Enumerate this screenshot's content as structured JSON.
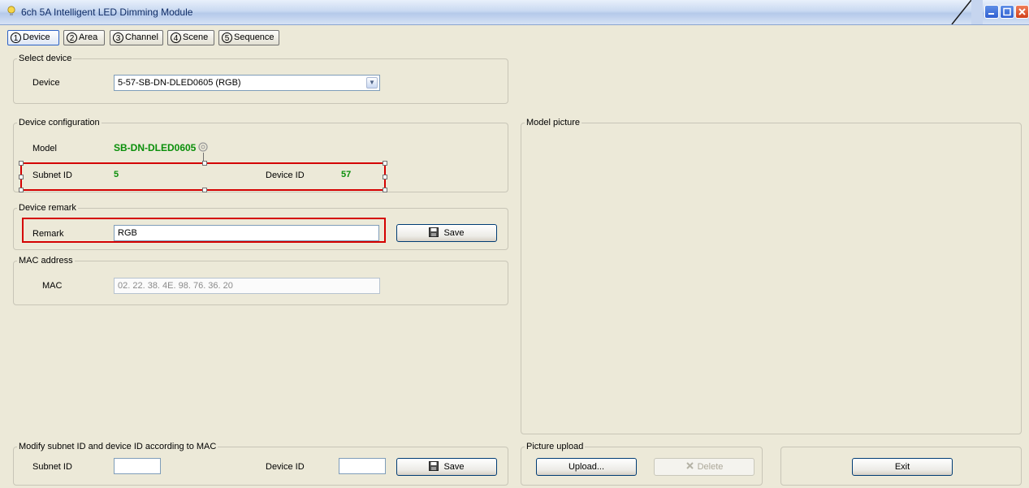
{
  "window": {
    "title": "6ch 5A Intelligent LED Dimming Module"
  },
  "tabs": [
    {
      "num": "1",
      "label": "Device",
      "active": true
    },
    {
      "num": "2",
      "label": "Area"
    },
    {
      "num": "3",
      "label": "Channel"
    },
    {
      "num": "4",
      "label": "Scene"
    },
    {
      "num": "5",
      "label": "Sequence"
    }
  ],
  "select_device": {
    "group_label": "Select device",
    "device_label": "Device",
    "device_value": "5-57-SB-DN-DLED0605 (RGB)"
  },
  "device_configuration": {
    "group_label": "Device configuration",
    "model_label": "Model",
    "model_value": "SB-DN-DLED0605",
    "subnet_label": "Subnet ID",
    "subnet_value": "5",
    "device_id_label": "Device ID",
    "device_id_value": "57"
  },
  "device_remark": {
    "group_label": "Device remark",
    "remark_label": "Remark",
    "remark_value": "RGB",
    "save_label": "Save"
  },
  "mac_address": {
    "group_label": "MAC address",
    "mac_label": "MAC",
    "mac_value": "02. 22. 38. 4E. 98. 76. 36. 20"
  },
  "modify_by_mac": {
    "group_label": "Modify subnet ID and device ID according to MAC",
    "subnet_label": "Subnet ID",
    "subnet_value": "",
    "device_id_label": "Device ID",
    "device_id_value": "",
    "save_label": "Save"
  },
  "model_picture": {
    "group_label": "Model picture"
  },
  "picture_upload": {
    "group_label": "Picture upload",
    "upload_label": "Upload...",
    "delete_label": "Delete"
  },
  "exit_label": "Exit",
  "colors": {
    "accent_green": "#0a8f0a",
    "highlight_red": "#d40000",
    "background": "#ece9d8"
  }
}
